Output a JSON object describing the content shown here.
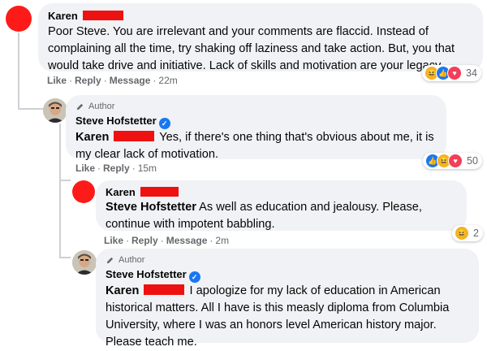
{
  "comments": [
    {
      "name": "Karen",
      "text": "Poor Steve. You are irrelevant and your comments are flaccid. Instead of complaining all the time, try shaking off laziness and take action. But, you that would take drive and initiative. Lack of skills and motivation are your legacy.",
      "actions": {
        "like": "Like",
        "reply": "Reply",
        "message": "Message",
        "time": "22m"
      },
      "reactions": {
        "icons": [
          "haha",
          "like",
          "love"
        ],
        "count": "34"
      }
    },
    {
      "badge": "Author",
      "name": "Steve Hofstetter",
      "tag": "Karen",
      "text": "Yes, if there's one thing that's obvious about me, it is my clear lack of motivation.",
      "actions": {
        "like": "Like",
        "reply": "Reply",
        "time": "15m"
      },
      "reactions": {
        "icons": [
          "like",
          "haha",
          "love"
        ],
        "count": "50"
      }
    },
    {
      "name": "Karen",
      "tag": "Steve Hofstetter",
      "text": "As well as education and jealousy. Please, continue with impotent babbling.",
      "actions": {
        "like": "Like",
        "reply": "Reply",
        "message": "Message",
        "time": "2m"
      },
      "reactions": {
        "icons": [
          "haha"
        ],
        "count": "2"
      }
    },
    {
      "badge": "Author",
      "name": "Steve Hofstetter",
      "tag": "Karen",
      "text": "I apologize for my lack of education in American historical matters. All I have is this measly diploma from Columbia University, where I was an honors level American history major. Please teach me."
    }
  ],
  "colors": {
    "bubble": "#f0f2f5",
    "meta": "#65676b",
    "redaction": "#ee1111",
    "verified": "#1877f2"
  }
}
